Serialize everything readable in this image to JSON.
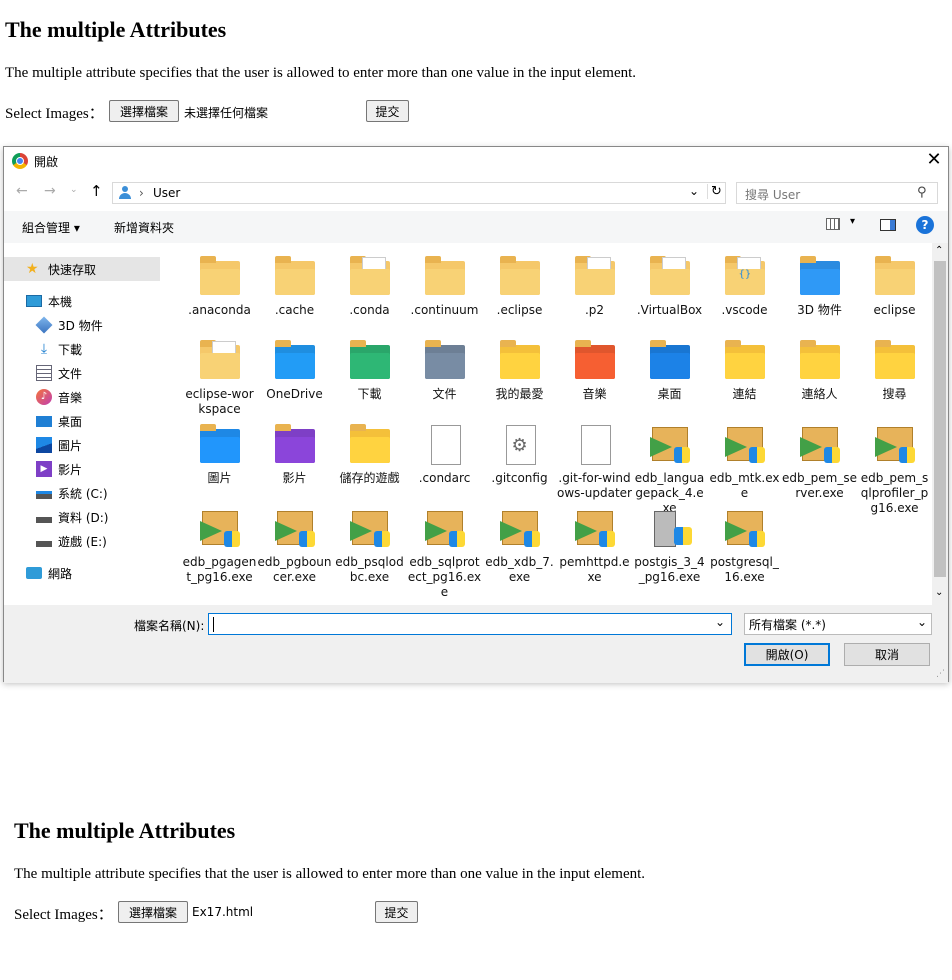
{
  "top": {
    "title": "The multiple Attributes",
    "description": "The multiple attribute specifies that the user is allowed to enter more than one value in the input element.",
    "select_label": "Select Images：",
    "choose_btn": "選擇檔案",
    "file_status": "未選擇任何檔案",
    "submit_btn": "提交"
  },
  "dialog": {
    "title": "開啟",
    "address": {
      "path_arrow": "›",
      "path": "User"
    },
    "search_placeholder": "搜尋 User",
    "commands": {
      "organize": "組合管理 ▾",
      "new_folder": "新增資料夾"
    },
    "sidebar": [
      {
        "label": "快速存取",
        "icon": "star-icon"
      },
      {
        "label": "本機",
        "icon": "pc-icon"
      },
      {
        "label": "3D 物件",
        "icon": "cube-icon"
      },
      {
        "label": "下載",
        "icon": "download-icon"
      },
      {
        "label": "文件",
        "icon": "document-icon"
      },
      {
        "label": "音樂",
        "icon": "music-icon"
      },
      {
        "label": "桌面",
        "icon": "desktop-icon"
      },
      {
        "label": "圖片",
        "icon": "picture-icon"
      },
      {
        "label": "影片",
        "icon": "video-icon"
      },
      {
        "label": "系統 (C:)",
        "icon": "drive-icon"
      },
      {
        "label": "資料 (D:)",
        "icon": "drive-icon"
      },
      {
        "label": "遊戲 (E:)",
        "icon": "drive-icon"
      },
      {
        "label": "網路",
        "icon": "network-icon"
      }
    ],
    "files": [
      {
        "name": ".anaconda",
        "icon": "folder"
      },
      {
        "name": ".cache",
        "icon": "folder"
      },
      {
        "name": ".conda",
        "icon": "folder-doc"
      },
      {
        "name": ".continuum",
        "icon": "folder"
      },
      {
        "name": ".eclipse",
        "icon": "folder"
      },
      {
        "name": ".p2",
        "icon": "folder-doc"
      },
      {
        "name": ".VirtualBox",
        "icon": "folder-doc"
      },
      {
        "name": ".vscode",
        "icon": "folder-code"
      },
      {
        "name": "3D 物件",
        "icon": "folder-3d"
      },
      {
        "name": "eclipse",
        "icon": "folder"
      },
      {
        "name": "eclipse-workspace",
        "icon": "folder-doc"
      },
      {
        "name": "OneDrive",
        "icon": "folder-cloud"
      },
      {
        "name": "下載",
        "icon": "folder-download"
      },
      {
        "name": "文件",
        "icon": "folder-docs"
      },
      {
        "name": "我的最愛",
        "icon": "folder-star"
      },
      {
        "name": "音樂",
        "icon": "folder-music"
      },
      {
        "name": "桌面",
        "icon": "folder-desktop"
      },
      {
        "name": "連結",
        "icon": "folder-link"
      },
      {
        "name": "連絡人",
        "icon": "folder-contact"
      },
      {
        "name": "搜尋",
        "icon": "folder-search"
      },
      {
        "name": "圖片",
        "icon": "folder-picture"
      },
      {
        "name": "影片",
        "icon": "folder-video"
      },
      {
        "name": "儲存的遊戲",
        "icon": "folder-game"
      },
      {
        "name": ".condarc",
        "icon": "file"
      },
      {
        "name": ".gitconfig",
        "icon": "file-gear"
      },
      {
        "name": ".git-for-windows-updater",
        "icon": "file"
      },
      {
        "name": "edb_languagepack_4.exe",
        "icon": "exe"
      },
      {
        "name": "edb_mtk.exe",
        "icon": "exe"
      },
      {
        "name": "edb_pem_server.exe",
        "icon": "exe"
      },
      {
        "name": "edb_pem_sqlprofiler_pg16.exe",
        "icon": "exe"
      },
      {
        "name": "edb_pgagent_pg16.exe",
        "icon": "exe"
      },
      {
        "name": "edb_pgbouncer.exe",
        "icon": "exe"
      },
      {
        "name": "edb_psqlodbc.exe",
        "icon": "exe"
      },
      {
        "name": "edb_sqlprotect_pg16.exe",
        "icon": "exe"
      },
      {
        "name": "edb_xdb_7.exe",
        "icon": "exe"
      },
      {
        "name": "pemhttpd.exe",
        "icon": "exe"
      },
      {
        "name": "postgis_3_4_pg16.exe",
        "icon": "exe-server"
      },
      {
        "name": "postgresql_16.exe",
        "icon": "exe"
      }
    ],
    "filename_label": "檔案名稱(N):",
    "filename_value": "",
    "filter": "所有檔案 (*.*)",
    "open_btn": "開啟(O)",
    "cancel_btn": "取消"
  },
  "bottom": {
    "title": "The multiple Attributes",
    "description": "The multiple attribute specifies that the user is allowed to enter more than one value in the input element.",
    "select_label": "Select Images：",
    "choose_btn": "選擇檔案",
    "file_status": "Ex17.html",
    "submit_btn": "提交"
  }
}
